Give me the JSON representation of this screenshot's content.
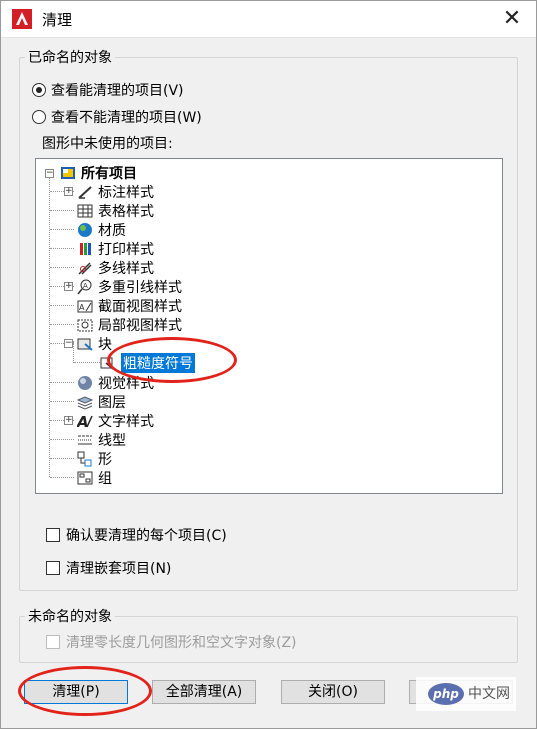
{
  "window": {
    "title": "清理",
    "close_glyph": "✕",
    "accent_color": "#0078d7",
    "annotation_color": "#e2231a"
  },
  "named_group": {
    "label": "已命名的对象",
    "radio_view_purgeable": "查看能清理的项目(V)",
    "radio_view_non_purgeable": "查看不能清理的项目(W)",
    "tree_label": "图形中未使用的项目:",
    "tree": {
      "root": "所有项目",
      "items": [
        "标注样式",
        "表格样式",
        "材质",
        "打印样式",
        "多线样式",
        "多重引线样式",
        "截面视图样式",
        "局部视图样式",
        "块",
        "粗糙度符号",
        "视觉样式",
        "图层",
        "文字样式",
        "线型",
        "形",
        "组"
      ],
      "selected": "粗糙度符号"
    },
    "confirm_each": "确认要清理的每个项目(C)",
    "purge_nested": "清理嵌套项目(N)"
  },
  "unnamed_group": {
    "label": "未命名的对象",
    "purge_zero_length": "清理零长度几何图形和空文字对象(Z)"
  },
  "buttons": {
    "purge": "清理(P)",
    "purge_all": "全部清理(A)",
    "close": "关闭(O)"
  },
  "watermark": {
    "logo": "php",
    "text": "中文网"
  }
}
